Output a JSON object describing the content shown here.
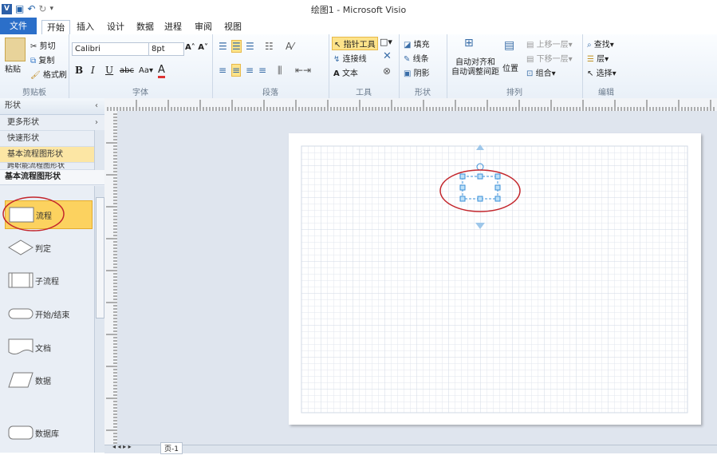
{
  "window": {
    "title": "绘图1 - Microsoft Visio"
  },
  "tabs": [
    "文件",
    "开始",
    "插入",
    "设计",
    "数据",
    "进程",
    "审阅",
    "视图"
  ],
  "ribbon": {
    "clipboard": {
      "paste": "粘贴",
      "cut": "剪切",
      "copy": "复制",
      "format_painter": "格式刷",
      "label": "剪贴板"
    },
    "font": {
      "name": "Calibri",
      "size": "8pt",
      "label": "字体"
    },
    "paragraph": {
      "label": "段落"
    },
    "tools": {
      "pointer": "指针工具",
      "connector": "连接线",
      "text": "文本",
      "label": "工具"
    },
    "shape": {
      "fill": "填充",
      "line": "线条",
      "shadow": "阴影",
      "label": "形状"
    },
    "arrange": {
      "auto_align": "自动对齐和",
      "auto_space": "自动调整间距",
      "position": "位置",
      "bring_forward": "上移一层",
      "send_backward": "下移一层",
      "group": "组合",
      "label": "排列"
    },
    "editing": {
      "find": "查找",
      "layers": "层",
      "select": "选择",
      "label": "编辑"
    }
  },
  "shapes_panel": {
    "header": "形状",
    "rows": [
      "更多形状",
      "快速形状",
      "基本流程图形状",
      "跨职能流程图形状"
    ],
    "stencil_title": "基本流程图形状",
    "shapes": [
      "流程",
      "判定",
      "子流程",
      "开始/结束",
      "文档",
      "数据",
      "数据库"
    ]
  },
  "status": {
    "page_tab": "页-1"
  },
  "colors": {
    "accent": "#2b6fc9",
    "highlight": "#fde38a",
    "annotation": "#c3262c",
    "selection": "#3a8fd8"
  }
}
